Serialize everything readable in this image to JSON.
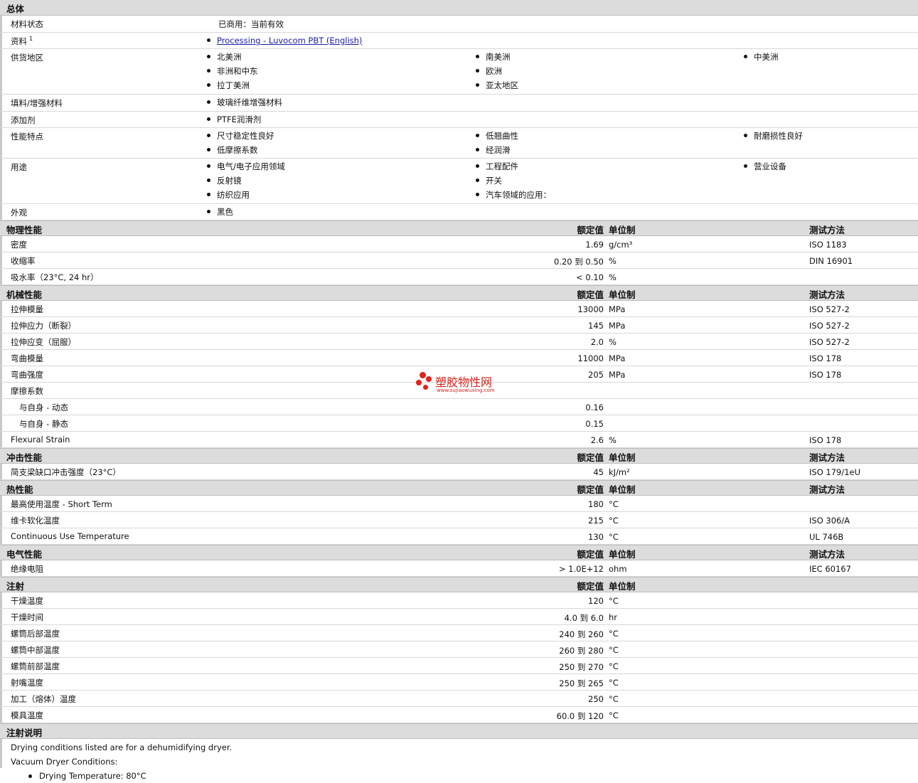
{
  "general": {
    "title": "总体",
    "rows": [
      {
        "label": "材料状态",
        "text": "已商用：当前有效"
      },
      {
        "label": "资料",
        "sup": "1",
        "link": "Processing - Luvocom PBT (English)"
      },
      {
        "label": "供货地区",
        "cols": [
          [
            "北美洲",
            "非洲和中东",
            "拉丁美洲"
          ],
          [
            "南美洲",
            "欧洲",
            "亚太地区"
          ],
          [
            "中美洲"
          ]
        ]
      },
      {
        "label": "填料/增强材料",
        "cols": [
          [
            "玻璃纤维增强材料"
          ]
        ]
      },
      {
        "label": "添加剂",
        "cols": [
          [
            "PTFE润滑剂"
          ]
        ]
      },
      {
        "label": "性能特点",
        "cols": [
          [
            "尺寸稳定性良好",
            "低摩擦系数"
          ],
          [
            "低翘曲性",
            "经润滑"
          ],
          [
            "耐磨损性良好"
          ]
        ]
      },
      {
        "label": "用途",
        "cols": [
          [
            "电气/电子应用领域",
            "反射镜",
            "纺织应用"
          ],
          [
            "工程配件",
            "开关",
            "汽车领域的应用："
          ],
          [
            "营业设备"
          ]
        ]
      },
      {
        "label": "外观",
        "cols": [
          [
            "黑色"
          ]
        ]
      }
    ]
  },
  "headers": {
    "nominal": "额定值",
    "unit": "单位制",
    "test": "测试方法"
  },
  "physical": {
    "title": "物理性能",
    "rows": [
      {
        "label": "密度",
        "value": "1.69",
        "unit": "g/cm³",
        "test": "ISO 1183"
      },
      {
        "label": "收缩率",
        "value": "0.20 到  0.50",
        "unit": "%",
        "test": "DIN 16901"
      },
      {
        "label": "吸水率（23°C, 24 hr）",
        "value": "< 0.10",
        "unit": "%",
        "test": ""
      }
    ]
  },
  "mechanical": {
    "title": "机械性能",
    "rows": [
      {
        "label": "拉伸模量",
        "value": "13000",
        "unit": "MPa",
        "test": "ISO 527-2"
      },
      {
        "label": "拉伸应力（断裂）",
        "value": "145",
        "unit": "MPa",
        "test": "ISO 527-2"
      },
      {
        "label": "拉伸应变（屈服）",
        "value": "2.0",
        "unit": "%",
        "test": "ISO 527-2"
      },
      {
        "label": "弯曲模量",
        "value": "11000",
        "unit": "MPa",
        "test": "ISO 178"
      },
      {
        "label": "弯曲强度",
        "value": "205",
        "unit": "MPa",
        "test": "ISO 178"
      },
      {
        "label": "摩擦系数",
        "value": "",
        "unit": "",
        "test": ""
      },
      {
        "label": "与自身   - 动态",
        "value": "0.16",
        "unit": "",
        "test": "",
        "indent": true
      },
      {
        "label": "与自身   - 静态",
        "value": "0.15",
        "unit": "",
        "test": "",
        "indent": true
      },
      {
        "label": "Flexural Strain",
        "value": "2.6",
        "unit": "%",
        "test": "ISO 178"
      }
    ]
  },
  "impact": {
    "title": "冲击性能",
    "rows": [
      {
        "label": "简支梁缺口冲击强度（23°C）",
        "value": "45",
        "unit": "kJ/m²",
        "test": "ISO 179/1eU"
      }
    ]
  },
  "thermal": {
    "title": "热性能",
    "rows": [
      {
        "label": "最高使用温度 - Short Term",
        "value": "180",
        "unit": "°C",
        "test": ""
      },
      {
        "label": "维卡软化温度",
        "value": "215",
        "unit": "°C",
        "test": "ISO 306/A"
      },
      {
        "label": "Continuous Use Temperature",
        "value": "130",
        "unit": "°C",
        "test": "UL 746B"
      }
    ]
  },
  "electrical": {
    "title": "电气性能",
    "rows": [
      {
        "label": "绝缘电阻",
        "value": "> 1.0E+12",
        "unit": "ohm",
        "test": "IEC 60167"
      }
    ]
  },
  "injection": {
    "title": "注射",
    "rows": [
      {
        "label": "干燥温度",
        "value": "120",
        "unit": "°C"
      },
      {
        "label": "干燥时间",
        "value": "4.0 到  6.0",
        "unit": "hr"
      },
      {
        "label": "螺筒后部温度",
        "value": "240 到  260",
        "unit": "°C"
      },
      {
        "label": "螺筒中部温度",
        "value": "260 到  280",
        "unit": "°C"
      },
      {
        "label": "螺筒前部温度",
        "value": "250 到  270",
        "unit": "°C"
      },
      {
        "label": "射嘴温度",
        "value": "250 到  265",
        "unit": "°C"
      },
      {
        "label": "加工（熔体）温度",
        "value": "250",
        "unit": "°C"
      },
      {
        "label": "模具温度",
        "value": "60.0 到  120",
        "unit": "°C"
      }
    ]
  },
  "injection_notes": {
    "title": "注射说明",
    "lines": [
      "Drying conditions listed are for a dehumidifying dryer.",
      "Vacuum Dryer Conditions:"
    ],
    "bullets": [
      "Drying Temperature: 80°C"
    ]
  },
  "watermark": {
    "brand": "塑胶物性网",
    "url": "www.sujiaowuxing.com",
    "color": "#d8231c"
  }
}
